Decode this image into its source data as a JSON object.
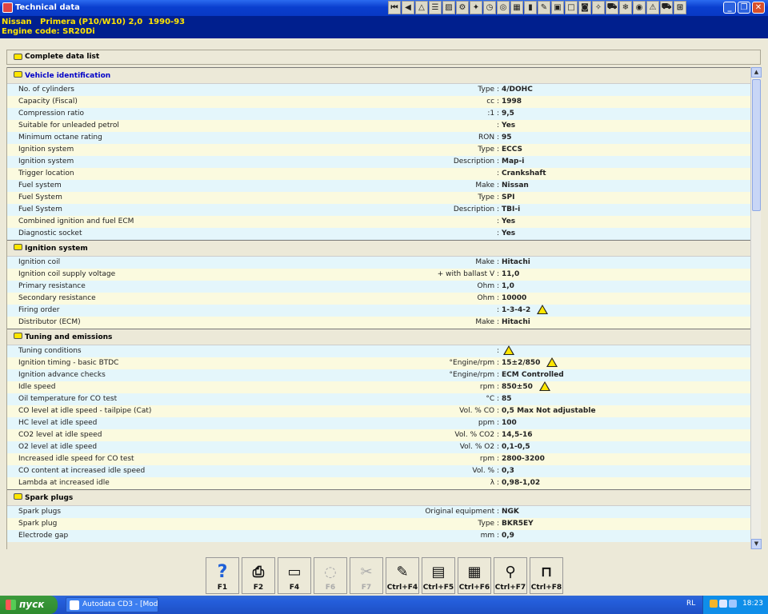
{
  "window": {
    "title": "Technical data"
  },
  "vehicle": {
    "model": "Nissan   Primera (P10/W10) 2,0  1990-93",
    "engine": "Engine code: SR20Di"
  },
  "complete_list_label": "Complete data list",
  "sections": [
    {
      "title": "Vehicle identification",
      "rows": [
        {
          "label": "No. of cylinders",
          "unit": "Type :",
          "value": "4/DOHC"
        },
        {
          "label": "Capacity (Fiscal)",
          "unit": "cc :",
          "value": "1998"
        },
        {
          "label": "Compression ratio",
          "unit": ":1 :",
          "value": "9,5"
        },
        {
          "label": "Suitable for unleaded petrol",
          "unit": ":",
          "value": "Yes"
        },
        {
          "label": "Minimum octane rating",
          "unit": "RON :",
          "value": "95"
        },
        {
          "label": "Ignition system",
          "unit": "Type :",
          "value": "ECCS"
        },
        {
          "label": "Ignition system",
          "unit": "Description :",
          "value": "Map-i"
        },
        {
          "label": "Trigger location",
          "unit": ":",
          "value": "Crankshaft"
        },
        {
          "label": "Fuel system",
          "unit": "Make :",
          "value": "Nissan"
        },
        {
          "label": "Fuel System",
          "unit": "Type :",
          "value": "SPI"
        },
        {
          "label": "Fuel System",
          "unit": "Description :",
          "value": "TBI-i"
        },
        {
          "label": "Combined ignition and fuel ECM",
          "unit": ":",
          "value": "Yes"
        },
        {
          "label": "Diagnostic socket",
          "unit": ":",
          "value": "Yes"
        }
      ]
    },
    {
      "title": "Ignition system",
      "rows": [
        {
          "label": "Ignition coil",
          "unit": "Make :",
          "value": "Hitachi"
        },
        {
          "label": "Ignition coil supply voltage",
          "unit": "+ with ballast  V :",
          "value": "11,0"
        },
        {
          "label": "Primary resistance",
          "unit": "Ohm :",
          "value": "1,0"
        },
        {
          "label": "Secondary resistance",
          "unit": "Ohm :",
          "value": "10000"
        },
        {
          "label": "Firing order",
          "unit": ":",
          "value": "1-3-4-2",
          "warn": true
        },
        {
          "label": "Distributor (ECM)",
          "unit": "Make :",
          "value": "Hitachi"
        }
      ]
    },
    {
      "title": "Tuning and emissions",
      "rows": [
        {
          "label": "Tuning conditions",
          "unit": ":",
          "value": "",
          "warn": true
        },
        {
          "label": "Ignition timing - basic  BTDC",
          "unit": "°Engine/rpm :",
          "value": "15±2/850",
          "warn": true
        },
        {
          "label": "Ignition advance checks",
          "unit": "°Engine/rpm :",
          "value": "ECM Controlled"
        },
        {
          "label": "Idle speed",
          "unit": "rpm :",
          "value": "850±50",
          "warn": true
        },
        {
          "label": "Oil temperature for CO test",
          "unit": "°C :",
          "value": "85"
        },
        {
          "label": "CO level at idle speed - tailpipe (Cat)",
          "unit": "Vol. % CO :",
          "value": "0,5 Max Not adjustable"
        },
        {
          "label": "HC level at idle speed",
          "unit": "ppm :",
          "value": "100"
        },
        {
          "label": "CO2 level at idle speed",
          "unit": "Vol. % CO2 :",
          "value": "14,5-16"
        },
        {
          "label": "O2 level at idle speed",
          "unit": "Vol. % O2 :",
          "value": "0,1-0,5"
        },
        {
          "label": "Increased idle speed for CO test",
          "unit": "rpm :",
          "value": "2800-3200"
        },
        {
          "label": "CO content at increased idle speed",
          "unit": "Vol. % :",
          "value": "0,3"
        },
        {
          "label": "Lambda at increased idle",
          "unit": "λ :",
          "value": "0,98-1,02"
        }
      ]
    },
    {
      "title": "Spark plugs",
      "rows": [
        {
          "label": "Spark plugs",
          "unit": "Original equipment :",
          "value": "NGK"
        },
        {
          "label": "Spark plug",
          "unit": "Type :",
          "value": "BKR5EY"
        },
        {
          "label": "Electrode gap",
          "unit": "mm :",
          "value": "0,9"
        }
      ]
    }
  ],
  "fkeys": [
    {
      "label": "F1",
      "icon": "help-icon",
      "glyph": "?",
      "enabled": true
    },
    {
      "label": "F2",
      "icon": "print-icon",
      "glyph": "⎙",
      "enabled": true
    },
    {
      "label": "F4",
      "icon": "monitor-icon",
      "glyph": "▭",
      "enabled": true
    },
    {
      "label": "F6",
      "icon": "diagram-icon",
      "glyph": "◌",
      "enabled": false
    },
    {
      "label": "F7",
      "icon": "tool-icon",
      "glyph": "✂",
      "enabled": false
    },
    {
      "label": "Ctrl+F4",
      "icon": "notes-icon",
      "glyph": "✎",
      "enabled": true
    },
    {
      "label": "Ctrl+F5",
      "icon": "document-icon",
      "glyph": "▤",
      "enabled": true
    },
    {
      "label": "Ctrl+F6",
      "icon": "calculator-icon",
      "glyph": "▦",
      "enabled": true
    },
    {
      "label": "Ctrl+F7",
      "icon": "search-icon",
      "glyph": "⚲",
      "enabled": true
    },
    {
      "label": "Ctrl+F8",
      "icon": "exit-icon",
      "glyph": "⊓",
      "enabled": true
    }
  ],
  "taskbar": {
    "start_label": "пуск",
    "task_label": "Autodata CD3 - [Mod...",
    "lang": "RL",
    "clock": "18:23"
  }
}
